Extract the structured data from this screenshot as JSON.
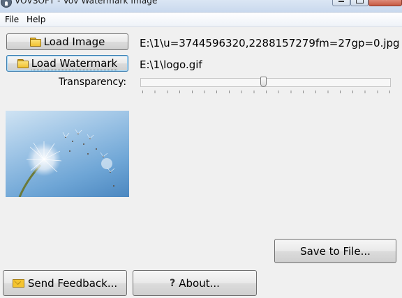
{
  "window": {
    "title": "VOVSOFT - Vov Watermark Image"
  },
  "menu": {
    "items": [
      "File",
      "Help"
    ]
  },
  "buttons": {
    "load_image": "Load Image",
    "load_watermark": "Load Watermark",
    "save_to_file": "Save to File...",
    "send_feedback": "Send Feedback...",
    "about": "About..."
  },
  "paths": {
    "image": "E:\\1\\u=3744596320,2288157279fm=27gp=0.jpg",
    "watermark": "E:\\1\\logo.gif"
  },
  "transparency": {
    "label": "Transparency:",
    "value_fraction": 0.49
  },
  "icons": {
    "load_image": "folder-icon",
    "load_watermark": "folder-icon",
    "send_feedback": "envelope-icon",
    "about": "help-icon"
  },
  "colors": {
    "window_bg": "#f0f0f0",
    "preview_sky": "#6fa6d6"
  }
}
